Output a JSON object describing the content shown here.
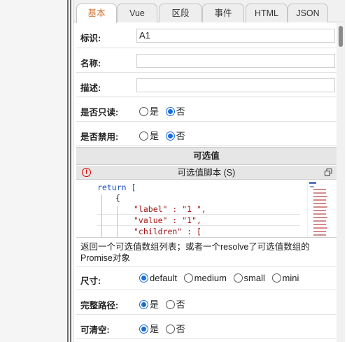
{
  "tabs": [
    {
      "label": "基本",
      "active": true
    },
    {
      "label": "Vue",
      "active": false
    },
    {
      "label": "区段",
      "active": false
    },
    {
      "label": "事件",
      "active": false
    },
    {
      "label": "HTML",
      "active": false
    },
    {
      "label": "JSON",
      "active": false
    }
  ],
  "fields": {
    "identifier": {
      "label": "标识:",
      "value": "A1"
    },
    "name": {
      "label": "名称:",
      "value": ""
    },
    "description": {
      "label": "描述:",
      "value": ""
    },
    "readonly": {
      "label": "是否只读:",
      "options": [
        "是",
        "否"
      ],
      "selected": "否"
    },
    "disabled": {
      "label": "是否禁用:",
      "options": [
        "是",
        "否"
      ],
      "selected": "否"
    }
  },
  "options_section": {
    "title": "可选值",
    "script_title": "可选值脚本 (S)",
    "code_lines": [
      "return [",
      "{",
      "\"label\" : \"1 \",",
      "\"value\" : \"1\",",
      "\"children\" : ["
    ],
    "help_text": "返回一个可选值数组列表；或者一个resolve了可选值数组的Promise对象"
  },
  "size": {
    "label": "尺寸:",
    "options": [
      "default",
      "medium",
      "small",
      "mini"
    ],
    "selected": "default"
  },
  "full_path": {
    "label": "完整路径:",
    "options": [
      "是",
      "否"
    ],
    "selected": "是"
  },
  "clearable": {
    "label": "可清空:",
    "options": [
      "是",
      "否"
    ],
    "selected": "是"
  },
  "colors": {
    "accent": "#d2691e",
    "radio": "#1a6ed8",
    "error": "#dd0000"
  }
}
